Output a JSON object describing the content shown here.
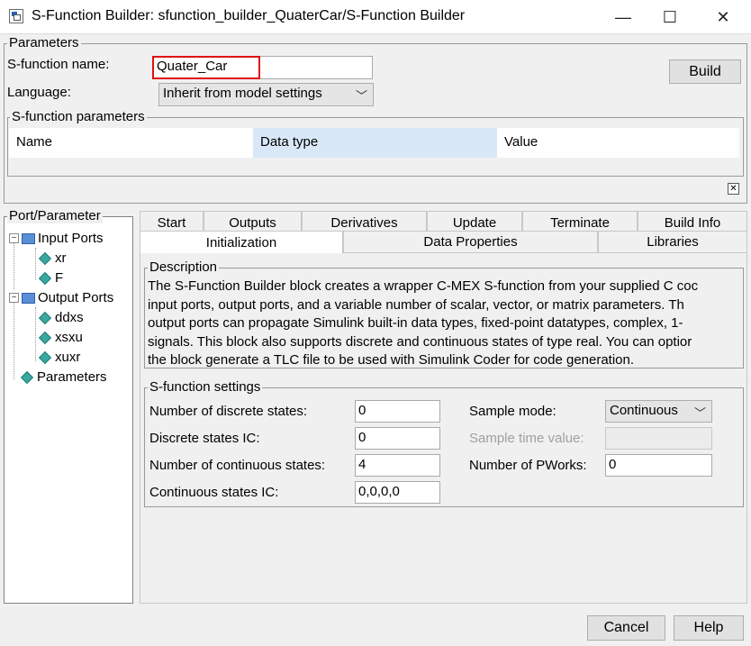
{
  "window": {
    "title": "S-Function Builder: sfunction_builder_QuaterCar/S-Function Builder",
    "icon": "simulink-block-icon",
    "minimize": "—",
    "maximize": "☐",
    "close": "✕"
  },
  "parameters": {
    "legend": "Parameters",
    "sfunction_name_label": "S-function name:",
    "sfunction_name_value": "Quater_Car",
    "highlight_color": "#e01010",
    "build_label": "Build",
    "language_label": "Language:",
    "language_value": "Inherit from model settings",
    "sfunction_parameters": {
      "legend": "S-function parameters",
      "columns": [
        "Name",
        "Data type",
        "Value"
      ],
      "close_glyph": "✕"
    }
  },
  "port_parameter": {
    "legend": "Port/Parameter",
    "input_ports_label": "Input Ports",
    "input_ports": [
      "xr",
      "F"
    ],
    "output_ports_label": "Output Ports",
    "output_ports": [
      "ddxs",
      "xsxu",
      "xuxr"
    ],
    "parameters_label": "Parameters"
  },
  "tabs": {
    "row1": [
      "Start",
      "Outputs",
      "Derivatives",
      "Update",
      "Terminate",
      "Build Info"
    ],
    "row2": [
      "Initialization",
      "Data Properties",
      "Libraries"
    ],
    "active": "Initialization"
  },
  "description": {
    "legend": "Description",
    "lines": [
      "The S-Function Builder block creates a wrapper C-MEX S-function from your supplied C coc",
      "input ports, output ports, and a variable number of scalar, vector, or matrix parameters. Th",
      "output ports can propagate Simulink built-in data types, fixed-point datatypes, complex, 1-",
      "signals. This block also supports discrete and continuous states of type real. You can optior",
      "the block generate a TLC file to be used with Simulink Coder for code generation."
    ]
  },
  "settings": {
    "legend": "S-function settings",
    "num_discrete_states_label": "Number of discrete states:",
    "num_discrete_states": "0",
    "discrete_states_ic_label": "Discrete states IC:",
    "discrete_states_ic": "0",
    "num_continuous_states_label": "Number of continuous states:",
    "num_continuous_states": "4",
    "continuous_states_ic_label": "Continuous states IC:",
    "continuous_states_ic": "0,0,0,0",
    "sample_mode_label": "Sample mode:",
    "sample_mode": "Continuous",
    "sample_time_value_label": "Sample time value:",
    "sample_time_value": "",
    "num_pworks_label": "Number of PWorks:",
    "num_pworks": "0"
  },
  "footer": {
    "cancel_label": "Cancel",
    "help_label": "Help"
  }
}
